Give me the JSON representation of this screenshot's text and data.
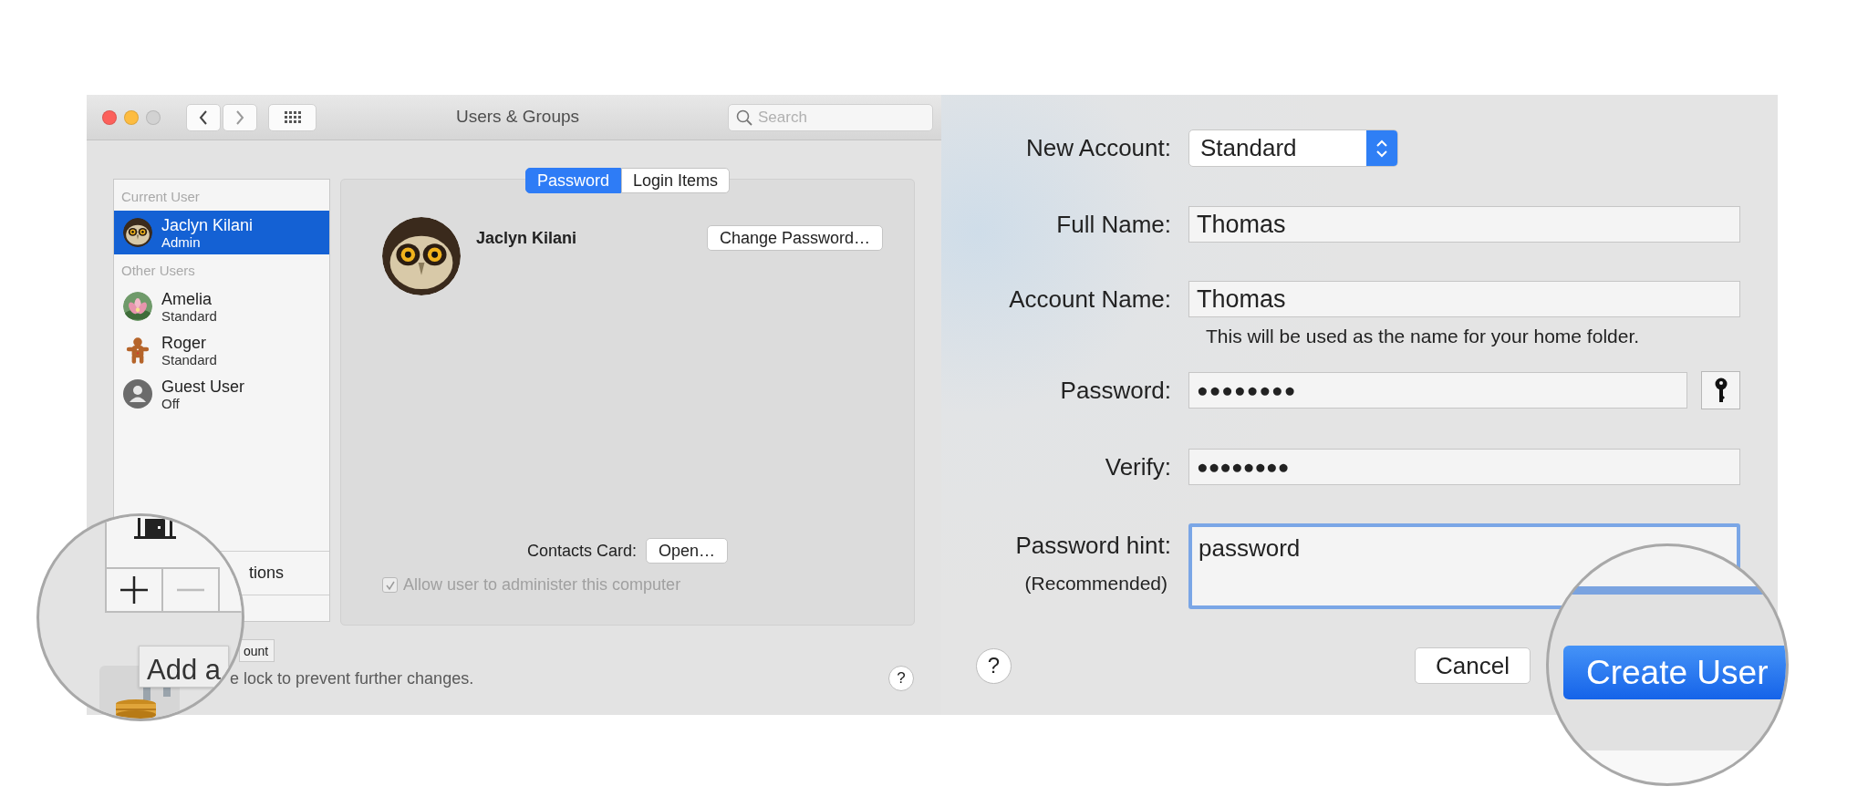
{
  "window": {
    "title": "Users & Groups",
    "search": {
      "placeholder": "Search"
    }
  },
  "sidebar": {
    "sections": [
      {
        "header": "Current User",
        "users": [
          {
            "name": "Jaclyn Kilani",
            "role": "Admin",
            "selected": true
          }
        ]
      },
      {
        "header": "Other Users",
        "users": [
          {
            "name": "Amelia",
            "role": "Standard",
            "selected": false
          },
          {
            "name": "Roger",
            "role": "Standard",
            "selected": false
          },
          {
            "name": "Guest User",
            "role": "Off",
            "kind": "silhouette",
            "selected": false
          }
        ]
      }
    ],
    "footer_label": "tions"
  },
  "tabs": [
    {
      "label": "Password",
      "selected": true
    },
    {
      "label": "Login Items",
      "selected": false
    }
  ],
  "user_panel": {
    "name": "Jaclyn Kilani",
    "change_password_button": "Change Password…",
    "contacts_label": "Contacts Card:",
    "open_button": "Open…",
    "admin_checkbox": {
      "label": "Allow user to administer this computer",
      "checked": true,
      "disabled": true
    }
  },
  "tooltip_tail": "ount",
  "lock_text": "e lock to prevent further changes.",
  "help_button": "?",
  "magnifier_left": {
    "tooltip": "Add a"
  },
  "dialog": {
    "fields": [
      {
        "kind": "popup",
        "label": "New Account:",
        "value": "Standard"
      },
      {
        "kind": "text",
        "label": "Full Name:",
        "value": "Thomas"
      },
      {
        "kind": "text",
        "label": "Account Name:",
        "value": "Thomas",
        "note": "This will be used as the name for your home folder."
      },
      {
        "kind": "password",
        "label": "Password:",
        "value": "●●●●●●●●",
        "key_button": true
      },
      {
        "kind": "password",
        "label": "Verify:",
        "value": "●●●●●●●●",
        "key_button": false
      },
      {
        "kind": "textarea",
        "label": "Password hint:",
        "sublabel": "(Recommended)",
        "value": "password",
        "focused": true
      }
    ],
    "help_button": "?",
    "cancel_button": "Cancel"
  },
  "magnifier_right": {
    "create_button": "Create User"
  }
}
